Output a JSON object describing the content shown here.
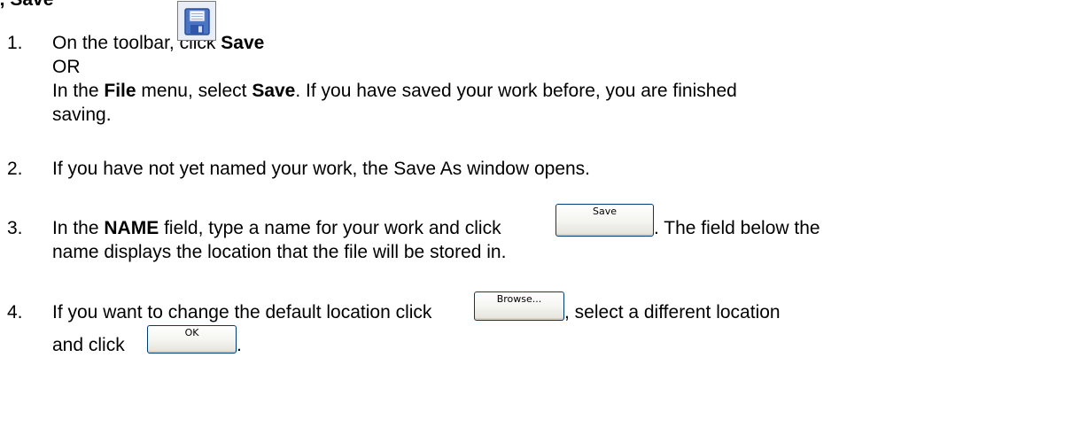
{
  "heading": "s, Save",
  "steps": [
    {
      "number": "1.",
      "line1_prefix": "On the toolbar, click ",
      "line1_bold": "Save",
      "or_text": "OR",
      "line3_prefix": "In the ",
      "line3_bold1": "File",
      "line3_mid": " menu, select ",
      "line3_bold2": "Save",
      "line3_suffix": ". If you have saved your work before, you are finished",
      "line4": "saving."
    },
    {
      "number": "2.",
      "text": "If you have not yet named your work, the Save As window opens."
    },
    {
      "number": "3.",
      "line1_prefix": "In the ",
      "line1_bold": "NAME",
      "line1_mid": " field, type a name for your work and click ",
      "line1_suffix": ". The field below the",
      "line2": "name displays the location that the file will be stored in."
    },
    {
      "number": "4.",
      "line1_prefix": "If you want to change the default location click ",
      "line1_suffix": ", select a different location",
      "line2_prefix": "and click ",
      "line2_suffix": "."
    }
  ],
  "buttons": {
    "save": "Save",
    "browse": "Browse...",
    "ok": "OK"
  },
  "icons": {
    "toolbar_save": "floppy-disk-icon"
  },
  "colors": {
    "text": "#000000",
    "button_border": "#003c74",
    "icon_blue": "#4b74c2"
  }
}
